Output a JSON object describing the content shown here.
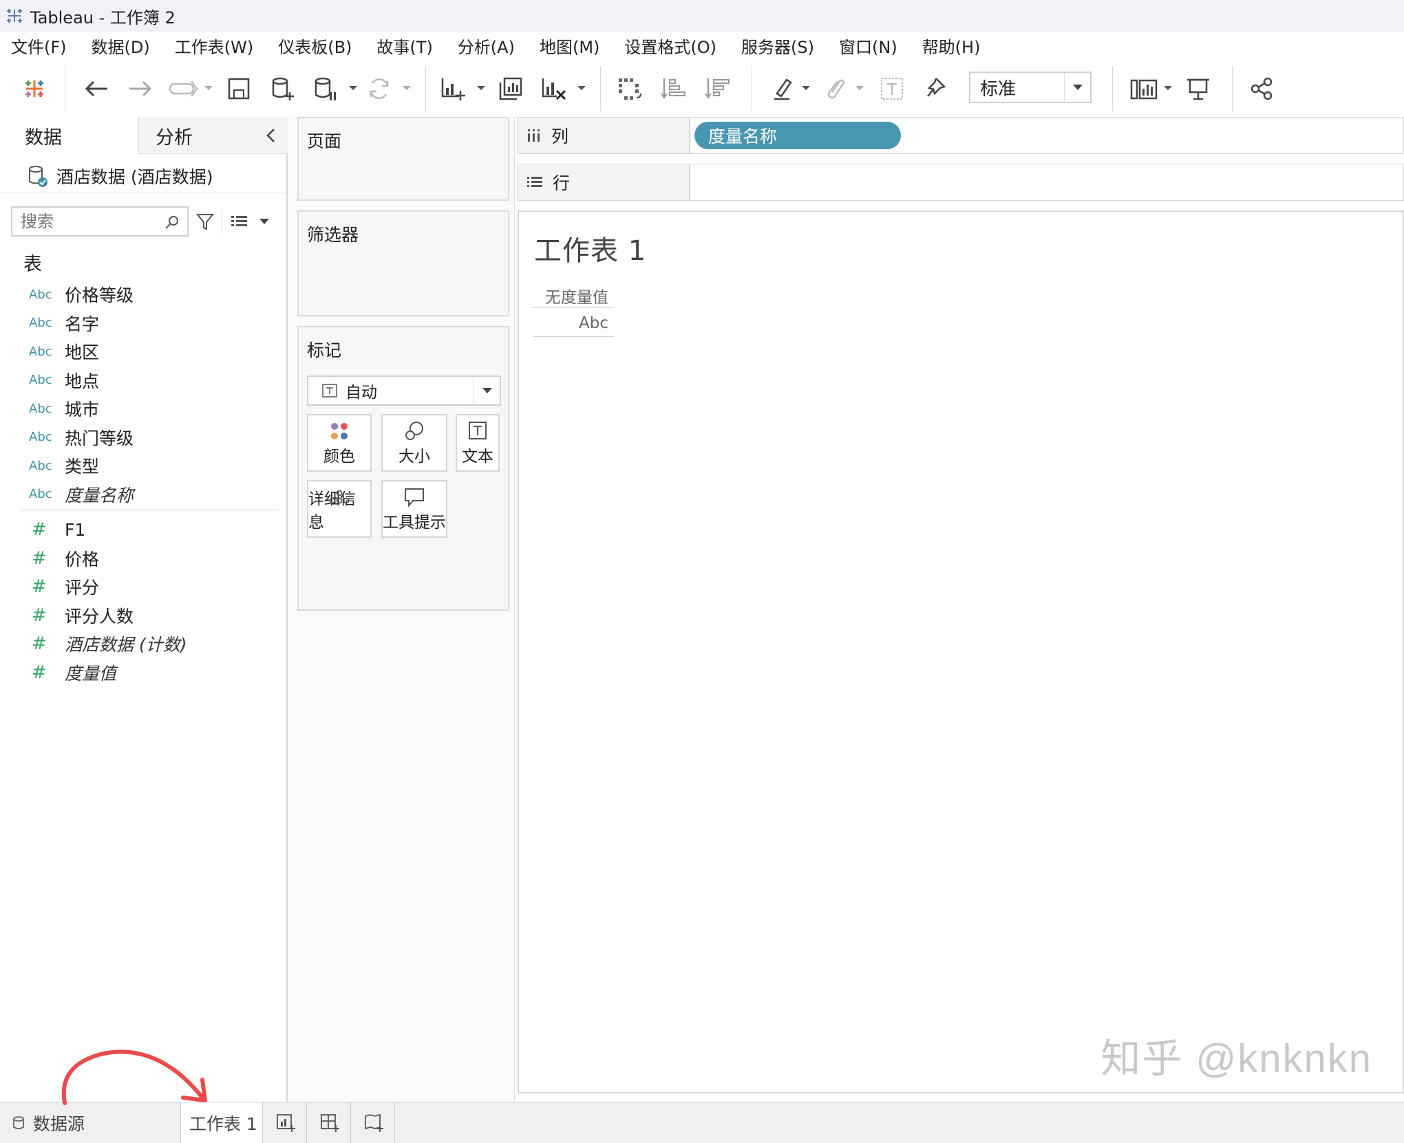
{
  "window": {
    "title": "Tableau - 工作簿 2"
  },
  "menu": {
    "items": [
      "文件(F)",
      "数据(D)",
      "工作表(W)",
      "仪表板(B)",
      "故事(T)",
      "分析(A)",
      "地图(M)",
      "设置格式(O)",
      "服务器(S)",
      "窗口(N)",
      "帮助(H)"
    ]
  },
  "toolbar": {
    "fit_select": "标准"
  },
  "left_pane": {
    "tabs": {
      "data": "数据",
      "analysis": "分析"
    },
    "datasource": "酒店数据 (酒店数据)",
    "search_placeholder": "搜索",
    "section": "表",
    "dimensions": [
      {
        "type": "Abc",
        "name": "价格等级",
        "italic": false
      },
      {
        "type": "Abc",
        "name": "名字",
        "italic": false
      },
      {
        "type": "Abc",
        "name": "地区",
        "italic": false
      },
      {
        "type": "Abc",
        "name": "地点",
        "italic": false
      },
      {
        "type": "Abc",
        "name": "城市",
        "italic": false
      },
      {
        "type": "Abc",
        "name": "热门等级",
        "italic": false
      },
      {
        "type": "Abc",
        "name": "类型",
        "italic": false
      },
      {
        "type": "Abc",
        "name": "度量名称",
        "italic": true
      }
    ],
    "measures": [
      {
        "type": "#",
        "name": "F1",
        "italic": false
      },
      {
        "type": "#",
        "name": "价格",
        "italic": false
      },
      {
        "type": "#",
        "name": "评分",
        "italic": false
      },
      {
        "type": "#",
        "name": "评分人数",
        "italic": false
      },
      {
        "type": "#",
        "name": "酒店数据 (计数)",
        "italic": true
      },
      {
        "type": "#",
        "name": "度量值",
        "italic": true
      }
    ]
  },
  "cards": {
    "pages": "页面",
    "filters": "筛选器",
    "marks": "标记",
    "marks_type": "自动",
    "mark_buttons": {
      "color": "颜色",
      "size": "大小",
      "text": "文本",
      "detail": "详细信息",
      "tooltip": "工具提示"
    }
  },
  "shelves": {
    "columns_label": "列",
    "rows_label": "行",
    "columns_pill": "度量名称"
  },
  "viz": {
    "title": "工作表 1",
    "header": "无度量值",
    "cell": "Abc"
  },
  "watermark": "知乎 @knknkn",
  "sheet_tabs": {
    "datasource": "数据源",
    "sheet1": "工作表 1"
  },
  "colors": {
    "pill": "#4897b1",
    "dimension": "#3f8fa8",
    "measure": "#3aa56a",
    "annotation_arrow": "#e84b4b"
  }
}
